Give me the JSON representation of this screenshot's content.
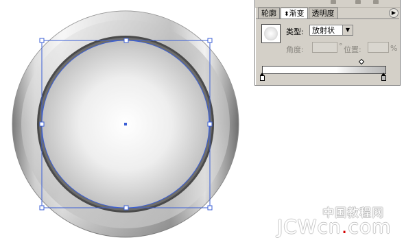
{
  "colors": {
    "panel_bg": "#d4d0c8",
    "selection": "#3b5fd6",
    "watermark_dot": "#d40000"
  },
  "artboard": {
    "object": "radial-gradient button (selected)",
    "selection_anchor_icon": "anchor-point-icon"
  },
  "gradient_panel": {
    "tabs": [
      {
        "label": "轮廓"
      },
      {
        "label": "渐变"
      },
      {
        "label": "透明度"
      }
    ],
    "menu_icon": "panel-menu-icon",
    "type_label": "类型:",
    "type_value": "放射状",
    "angle_label": "角度:",
    "location_label": "位置:",
    "degree_symbol": "°",
    "percent_symbol": "%",
    "angle_value": "",
    "location_value": "",
    "gradient": {
      "start_color": "#ffffff",
      "end_color": "#b8b8b8",
      "midpoint_percent": 80
    }
  },
  "watermark": {
    "chinese": "中国教程网",
    "latin_prefix": "JCWcn",
    "dot": ".",
    "latin_suffix": "com"
  }
}
